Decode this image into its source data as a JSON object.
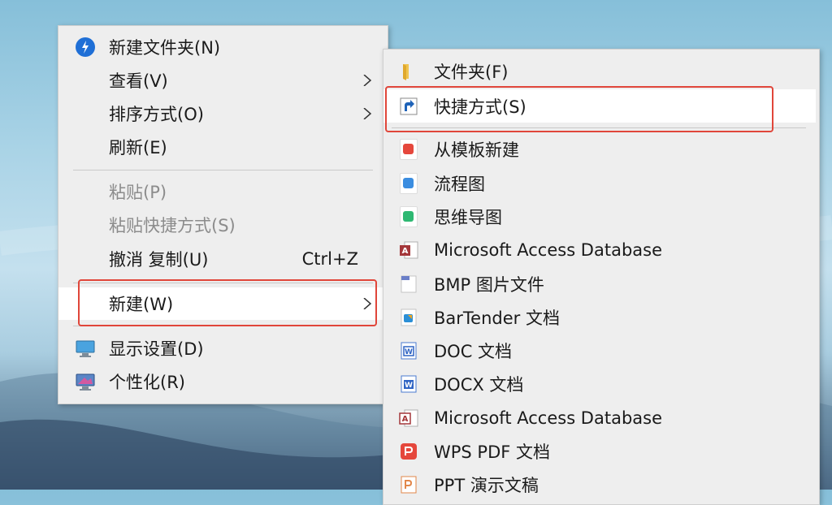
{
  "main_menu": {
    "items": [
      {
        "label": "新建文件夹(N)",
        "icon": "new-folder-icon"
      },
      {
        "label": "查看(V)",
        "submenu": true
      },
      {
        "label": "排序方式(O)",
        "submenu": true
      },
      {
        "label": "刷新(E)"
      },
      {
        "label": "粘贴(P)",
        "disabled": true
      },
      {
        "label": "粘贴快捷方式(S)",
        "disabled": true
      },
      {
        "label": "撤消 复制(U)",
        "shortcut": "Ctrl+Z"
      },
      {
        "label": "新建(W)",
        "submenu": true,
        "highlighted": true
      },
      {
        "label": "显示设置(D)",
        "icon": "monitor-icon"
      },
      {
        "label": "个性化(R)",
        "icon": "personalize-icon"
      }
    ]
  },
  "sub_menu": {
    "items": [
      {
        "label": "文件夹(F)",
        "icon": "folder-icon"
      },
      {
        "label": "快捷方式(S)",
        "icon": "shortcut-icon",
        "highlighted": true
      },
      {
        "label": "从模板新建",
        "icon": "template-icon"
      },
      {
        "label": "流程图",
        "icon": "flowchart-icon"
      },
      {
        "label": "思维导图",
        "icon": "mindmap-icon"
      },
      {
        "label": "Microsoft Access Database",
        "icon": "access-icon"
      },
      {
        "label": "BMP 图片文件",
        "icon": "bmp-icon"
      },
      {
        "label": "BarTender 文档",
        "icon": "bartender-icon"
      },
      {
        "label": "DOC 文档",
        "icon": "doc-icon"
      },
      {
        "label": "DOCX 文档",
        "icon": "docx-icon"
      },
      {
        "label": "Microsoft Access Database",
        "icon": "access-icon"
      },
      {
        "label": "WPS PDF 文档",
        "icon": "pdf-icon"
      },
      {
        "label": "PPT 演示文稿",
        "icon": "ppt-icon"
      }
    ]
  },
  "colors": {
    "highlight_box": "#e0463a",
    "menu_bg": "#eeeeee"
  }
}
